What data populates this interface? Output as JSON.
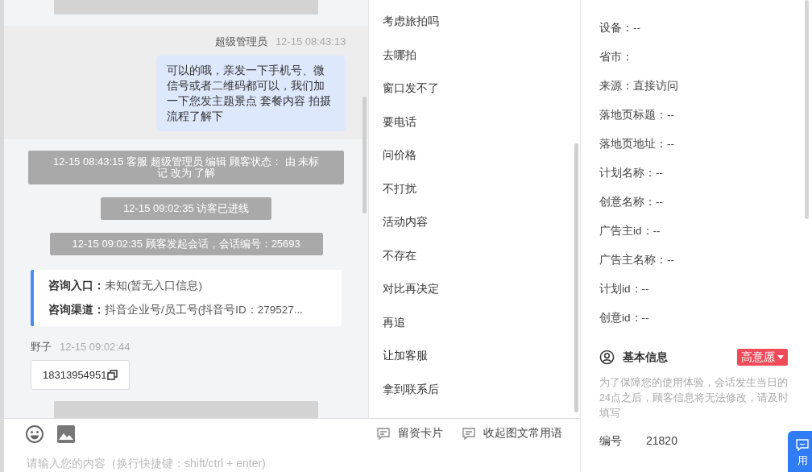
{
  "chat": {
    "messages": [
      {
        "kind": "bar"
      },
      {
        "kind": "agent",
        "sender": "超级管理员",
        "time": "12-15 08:43:13",
        "text": "可以的哦，亲发一下手机号、微信号或者二维码都可以，我们加一下您发主题景点 套餐内容 拍摄流程了解下"
      },
      {
        "kind": "system",
        "text": "12-15 08:43:15 客服 超级管理员 编辑 顾客状态： 由 未标记 改为 了解"
      },
      {
        "kind": "system",
        "text": "12-15 09:02:35 访客已进线"
      },
      {
        "kind": "system",
        "text": "12-15 09:02:35 顾客发起会话，会话编号：25693"
      },
      {
        "kind": "info",
        "rows": [
          {
            "label": "咨询入口：",
            "value": "未知(暂无入口信息)"
          },
          {
            "label": "咨询渠道：",
            "value": "抖音企业号/员工号(抖音号ID：279527..."
          }
        ]
      },
      {
        "kind": "visitor",
        "sender": "野子",
        "time": "12-15 09:02:44",
        "text": "18313954951"
      },
      {
        "kind": "bar"
      }
    ]
  },
  "phrases": [
    "考虑旅拍吗",
    "去哪拍",
    "窗口发不了",
    "要电话",
    "问价格",
    "不打扰",
    "活动内容",
    "不存在",
    "对比再决定",
    "再追",
    "让加客服",
    "拿到联系后"
  ],
  "composer": {
    "tools": [
      "留资卡片",
      "收起图文常用语"
    ],
    "placeholder": "请输入您的内容（换行快捷键：shift/ctrl + enter)"
  },
  "source_info": {
    "fields": [
      "设备：--",
      "省市：",
      "来源：直接访问",
      "落地页标题：--",
      "落地页地址：--",
      "计划名称：--",
      "创意名称：--",
      "广告主id：--",
      "广告主名称：--",
      "计划id：--",
      "创意id：--"
    ]
  },
  "basic_info": {
    "title": "基本信息",
    "intent": "高意愿",
    "note": "为了保障您的使用体验，会话发生当日的24点之后，顾客信息将无法修改，请及时填写",
    "fields": [
      {
        "label": "编号",
        "value": "21820"
      }
    ]
  },
  "float_button": {
    "label": "用"
  }
}
